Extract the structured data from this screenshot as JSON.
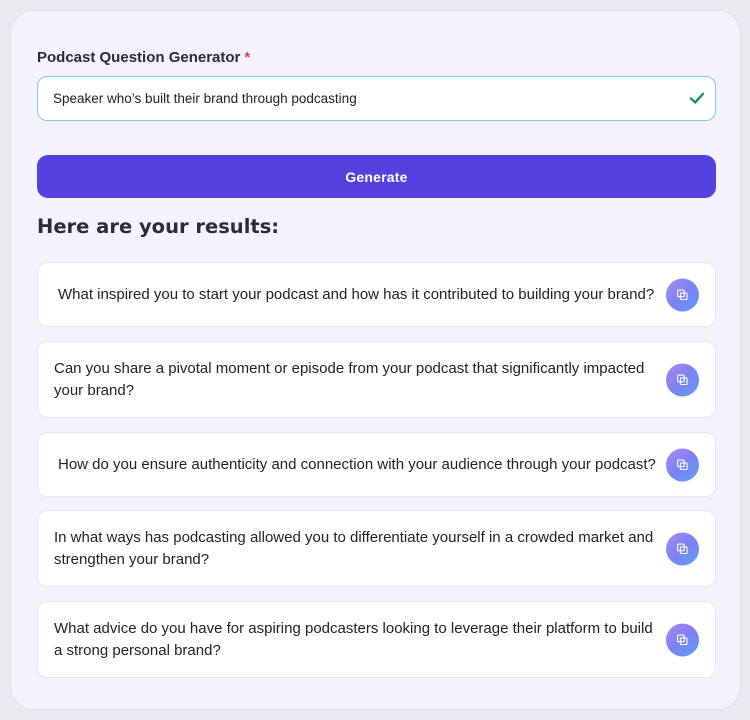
{
  "form": {
    "label": "Podcast Question Generator",
    "required_mark": "*",
    "input_value": "Speaker who’s built their brand through podcasting",
    "input_valid_icon": "checkmark-icon",
    "generate_label": "Generate"
  },
  "results": {
    "heading": "Here are your results:",
    "copy_icon": "copy-icon",
    "items": [
      {
        "text": "What inspired you to start your podcast and how has it contributed to building your brand?"
      },
      {
        "text": "Can you share a pivotal moment or episode from your podcast that significantly impacted your brand?"
      },
      {
        "text": "How do you ensure authenticity and connection with your audience through your podcast?"
      },
      {
        "text": "In what ways has podcasting allowed you to differentiate yourself in a crowded market and strengthen your brand?"
      },
      {
        "text": "What advice do you have for aspiring podcasters looking to leverage their platform to build a strong personal brand?"
      }
    ]
  },
  "colors": {
    "accent": "#5440dc",
    "valid_border": "#7fd1c4",
    "valid_check": "#1f8f63",
    "required": "#e23b4e"
  }
}
